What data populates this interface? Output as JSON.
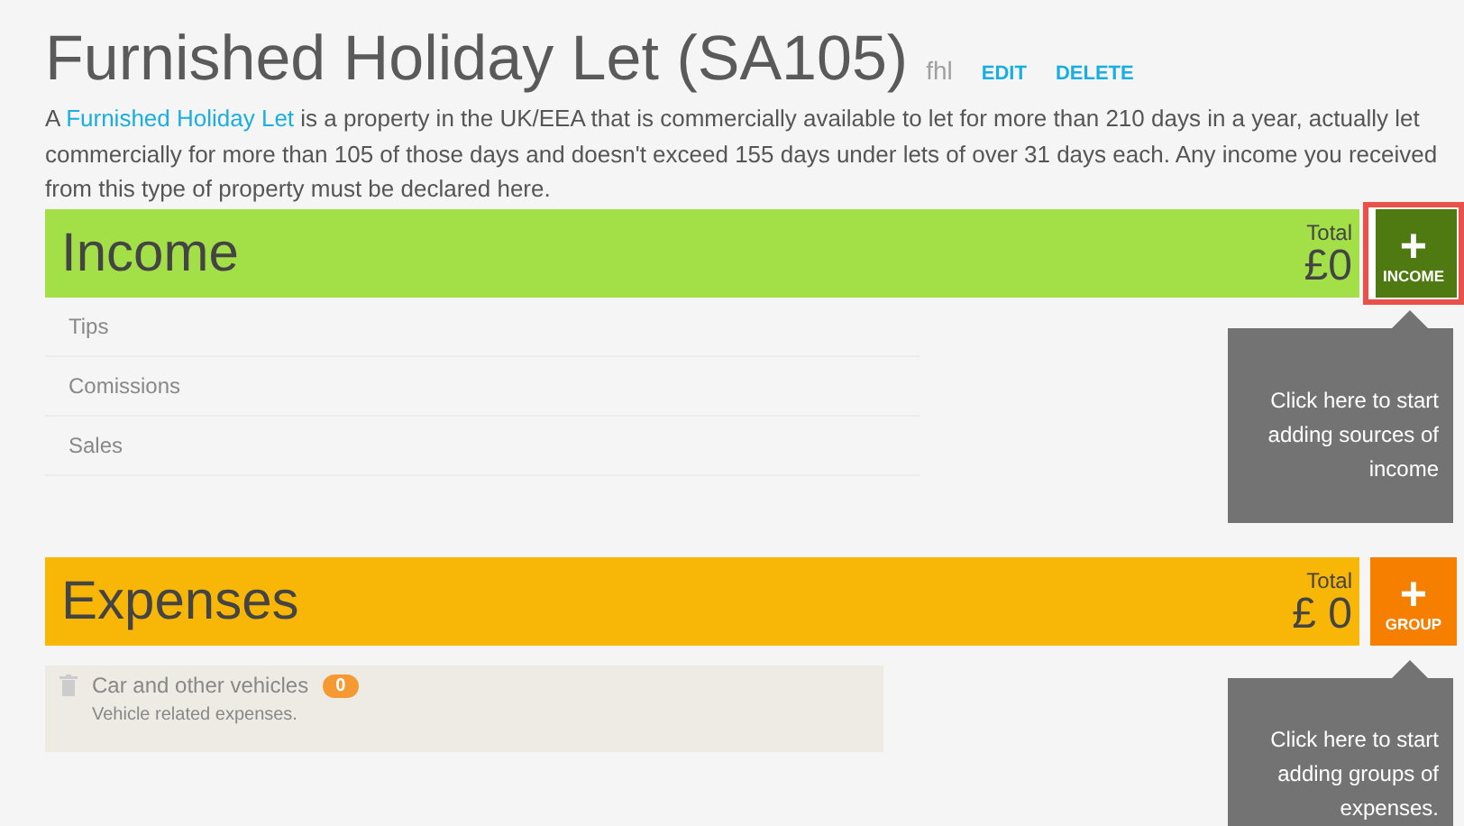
{
  "header": {
    "title": "Furnished Holiday Let (SA105)",
    "code": "fhl",
    "actions": [
      "EDIT",
      "DELETE"
    ]
  },
  "description": {
    "before": "A",
    "link": "Furnished Holiday Let",
    "after": "is a property in the UK/EEA that is commercially available to let for more than 210 days in a year, actually let commercially for more than 105 of those days and doesn't exceed 155 days under lets of over 31 days each. Any income you received from this type of property must be declared here."
  },
  "sections": [
    {
      "kind": "income",
      "title": "Income",
      "total_label": "Total",
      "total": "£0",
      "add_button": {
        "icon": "+",
        "label": "INCOME",
        "highlighted": true
      },
      "items": [
        {
          "name": "Tips"
        },
        {
          "name": "Comissions"
        },
        {
          "name": "Sales"
        }
      ],
      "tooltip": "Click here to start adding sources of income"
    },
    {
      "kind": "expenses",
      "title": "Expenses",
      "total_label": "Total",
      "total": "£ 0",
      "add_button": {
        "icon": "+",
        "label": "GROUP",
        "highlighted": false
      },
      "groups": [
        {
          "name": "Car and other vehicles",
          "count": "0",
          "note": "Vehicle related expenses."
        }
      ],
      "tooltip": "Click here to start adding groups of expenses."
    }
  ]
}
